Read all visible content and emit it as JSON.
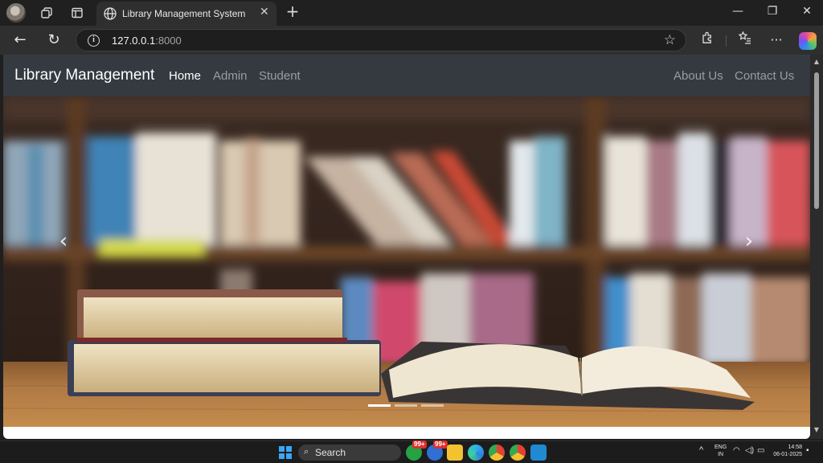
{
  "browser": {
    "tab": {
      "title": "Library Management System",
      "close": "✕"
    },
    "new_tab": "+",
    "window_controls": {
      "minimize": "—",
      "restore": "❐",
      "close": "✕"
    },
    "address": {
      "host": "127.0.0.1",
      "port": ":8000"
    },
    "nav": {
      "back": "←",
      "reload": "↻"
    },
    "toolbar": {
      "star": "☆",
      "extensions": "⬡",
      "favorites": "☆≡",
      "more": "···"
    }
  },
  "page": {
    "brand": "Library Management",
    "nav_left": [
      {
        "label": "Home",
        "active": true
      },
      {
        "label": "Admin",
        "active": false
      },
      {
        "label": "Student",
        "active": false
      }
    ],
    "nav_right": [
      {
        "label": "About Us"
      },
      {
        "label": "Contact Us"
      }
    ],
    "carousel": {
      "image": "library-books-on-table-photo",
      "prev": "‹",
      "next": "›",
      "indicators": 3,
      "active_indicator": 0
    }
  },
  "scrollbar": {
    "up": "▲",
    "down": "▼"
  },
  "taskbar": {
    "search_label": "Search",
    "badges": [
      "99+",
      "99+"
    ],
    "tray": {
      "lang_1": "ENG",
      "lang_2": "IN",
      "time": "14:58",
      "date": "06-01-2025",
      "chevron": "^"
    }
  },
  "colors": {
    "navbar": "#343a40",
    "chrome_bg": "#202020",
    "toolbar_bg": "#2f2f2f",
    "accent": "#3ba6f5"
  }
}
